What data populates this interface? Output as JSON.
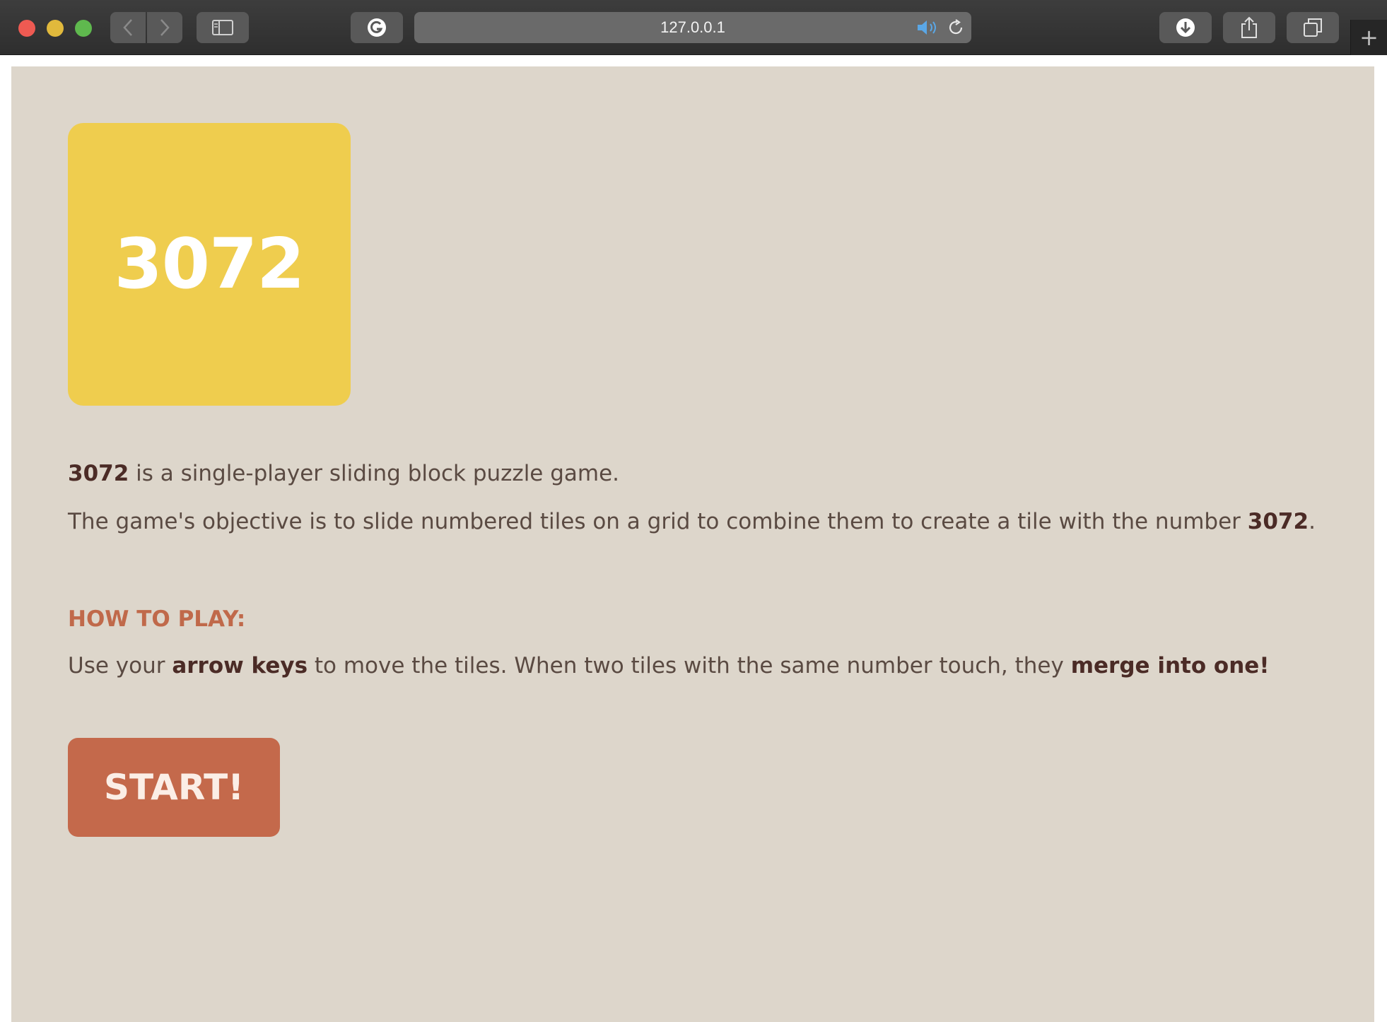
{
  "browser": {
    "url": "127.0.0.1",
    "new_tab_label": "+"
  },
  "game": {
    "logo_number": "3072",
    "intro": {
      "bold": "3072",
      "rest": " is a single-player sliding block puzzle game."
    },
    "objective": {
      "text": "The game's objective is to slide numbered tiles on a grid to combine them to create a tile with the number ",
      "bold": "3072",
      "end": "."
    },
    "how_to_play_heading": "HOW TO PLAY:",
    "instructions": {
      "part1": "Use your ",
      "bold1": "arrow keys",
      "part2": " to move the tiles. When two tiles with the same number touch, they ",
      "bold2": "merge into one!"
    },
    "start_label": "START!"
  },
  "colors": {
    "background": "#ddd6cb",
    "logo_tile": "#efcd4e",
    "heading": "#c0694a",
    "start_button": "#c4694b"
  },
  "icons": [
    "back-icon",
    "forward-icon",
    "sidebar-icon",
    "grammarly-icon",
    "speaker-icon",
    "reload-icon",
    "download-icon",
    "share-icon",
    "tabs-icon"
  ]
}
